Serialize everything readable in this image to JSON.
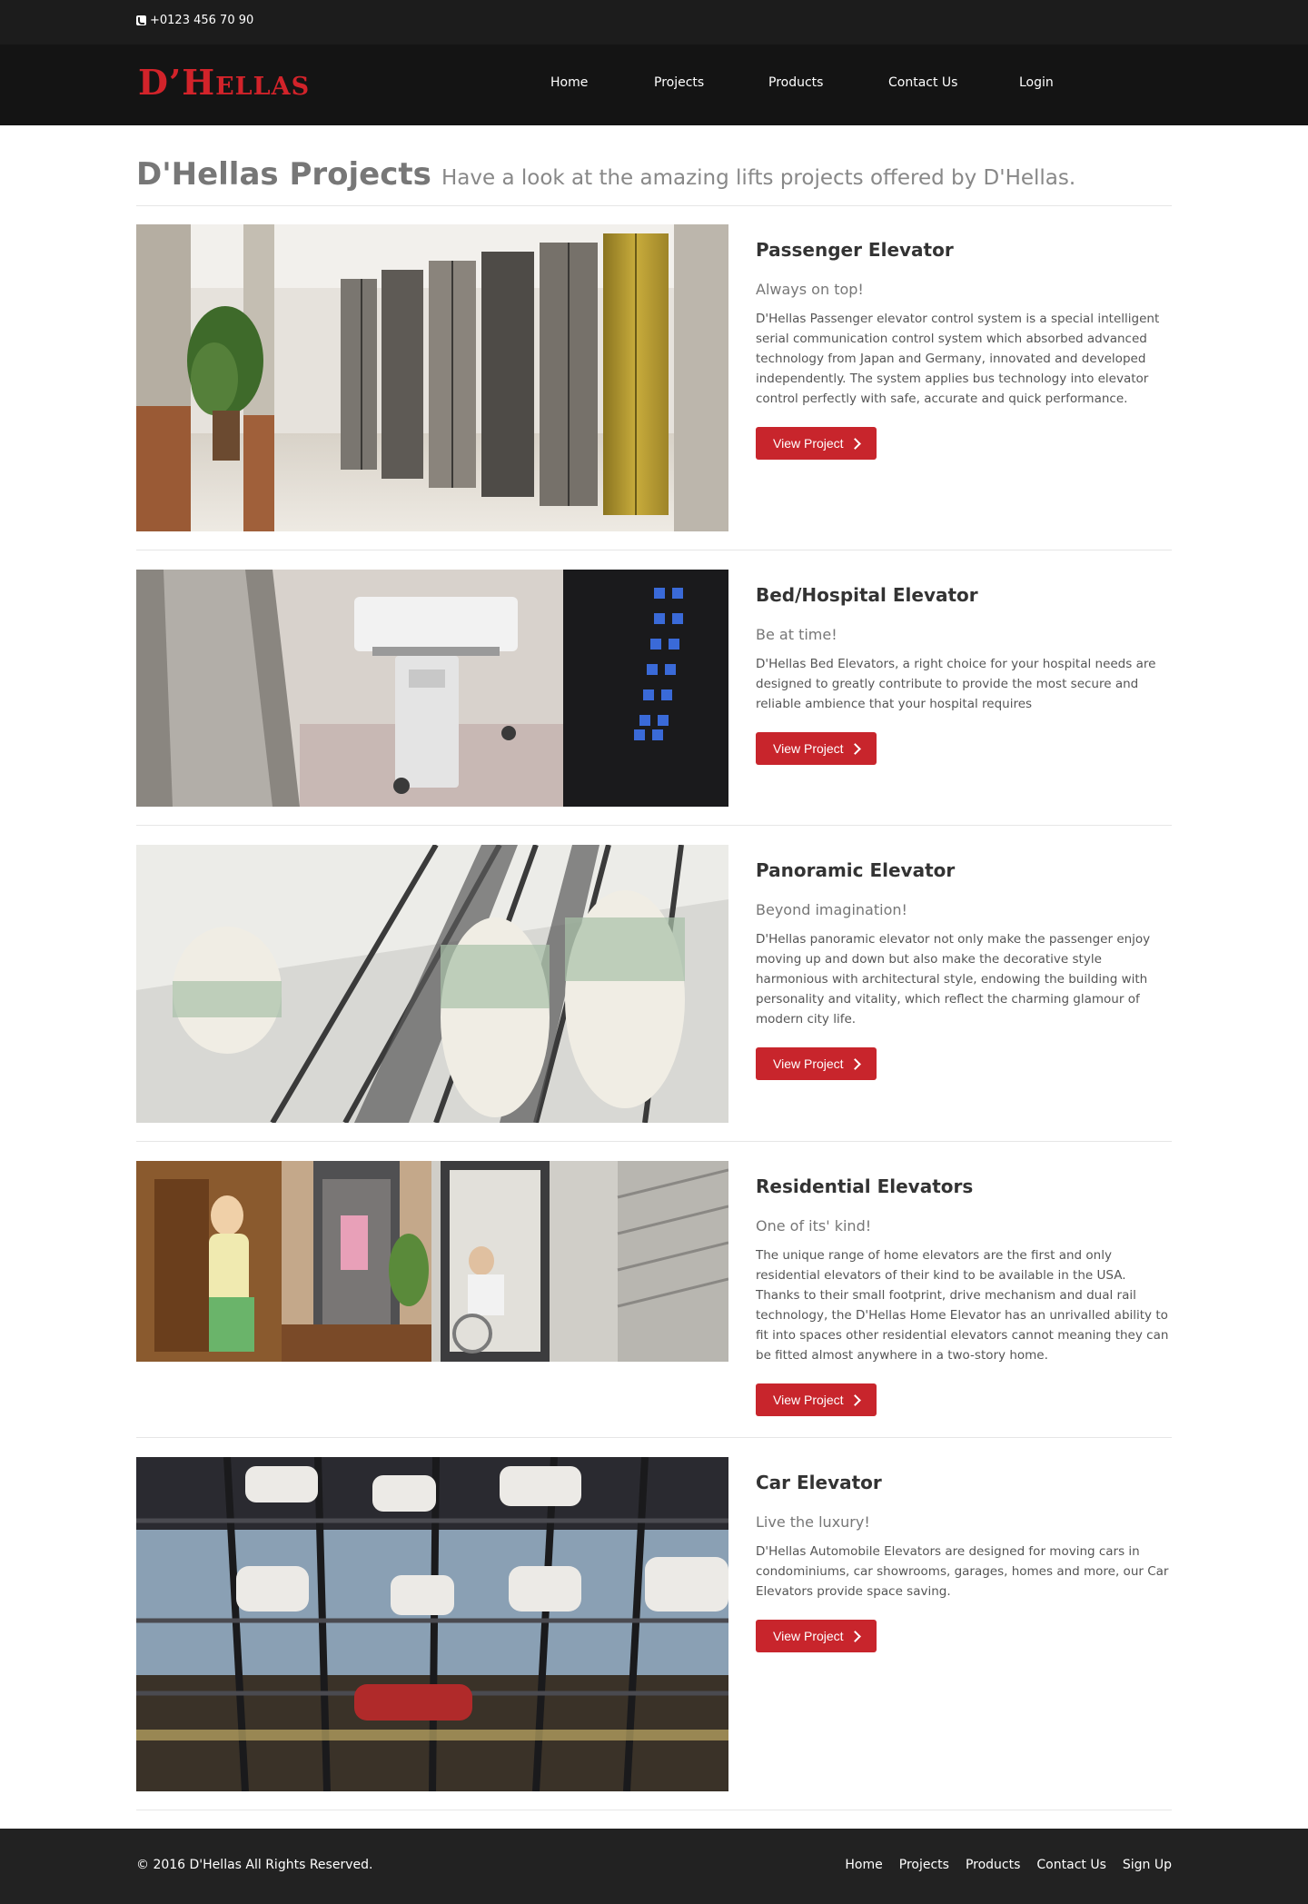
{
  "topbar": {
    "phone": "+0123 456 70 90"
  },
  "brand": {
    "logo_d": "D",
    "logo_apos": "’",
    "logo_h": "H",
    "logo_rest": "ELLAS"
  },
  "nav": {
    "home": "Home",
    "projects": "Projects",
    "products": "Products",
    "contact": "Contact Us",
    "login": "Login"
  },
  "header": {
    "title": "D'Hellas Projects",
    "subtitle": "Have a look at the amazing lifts projects offered by D'Hellas."
  },
  "projects": [
    {
      "title": "Passenger Elevator",
      "tagline": "Always on top!",
      "description": "D'Hellas Passenger elevator control system is a special intelligent serial communication control system which absorbed advanced technology from Japan and Germany, innovated and developed independently. The system applies bus technology into elevator control perfectly with safe, accurate and quick performance.",
      "button": "View Project"
    },
    {
      "title": "Bed/Hospital Elevator",
      "tagline": "Be at time!",
      "description": "D'Hellas Bed Elevators, a right choice for your hospital needs are designed to greatly contribute to provide the most secure and reliable ambience that your hospital requires",
      "button": "View Project"
    },
    {
      "title": "Panoramic Elevator",
      "tagline": "Beyond imagination!",
      "description": "D'Hellas panoramic elevator not only make the passenger enjoy moving up and down but also make the decorative style harmonious with architectural style, endowing the building with personality and vitality, which reflect the charming glamour of modern city life.",
      "button": "View Project"
    },
    {
      "title": "Residential Elevators",
      "tagline": "One of its' kind!",
      "description": "The unique range of home elevators are the first and only residential elevators of their kind to be available in the USA. Thanks to their small footprint, drive mechanism and dual rail technology, the D'Hellas Home Elevator has an unrivalled ability to fit into spaces other residential elevators cannot meaning they can be fitted almost anywhere in a two-story home.",
      "button": "View Project"
    },
    {
      "title": "Car Elevator",
      "tagline": "Live the luxury!",
      "description": "D'Hellas Automobile Elevators are designed for moving cars in condominiums, car showrooms, garages, homes and more, our Car Elevators provide space saving.",
      "button": "View Project"
    }
  ],
  "footer": {
    "copyright": "© 2016 D'Hellas All Rights Reserved.",
    "links": {
      "home": "Home",
      "projects": "Projects",
      "products": "Products",
      "contact": "Contact Us",
      "signup": "Sign Up"
    }
  },
  "colors": {
    "accent": "#c8252c",
    "topbar": "#1c1c1c",
    "navbar": "#141414",
    "footer": "#222222"
  }
}
